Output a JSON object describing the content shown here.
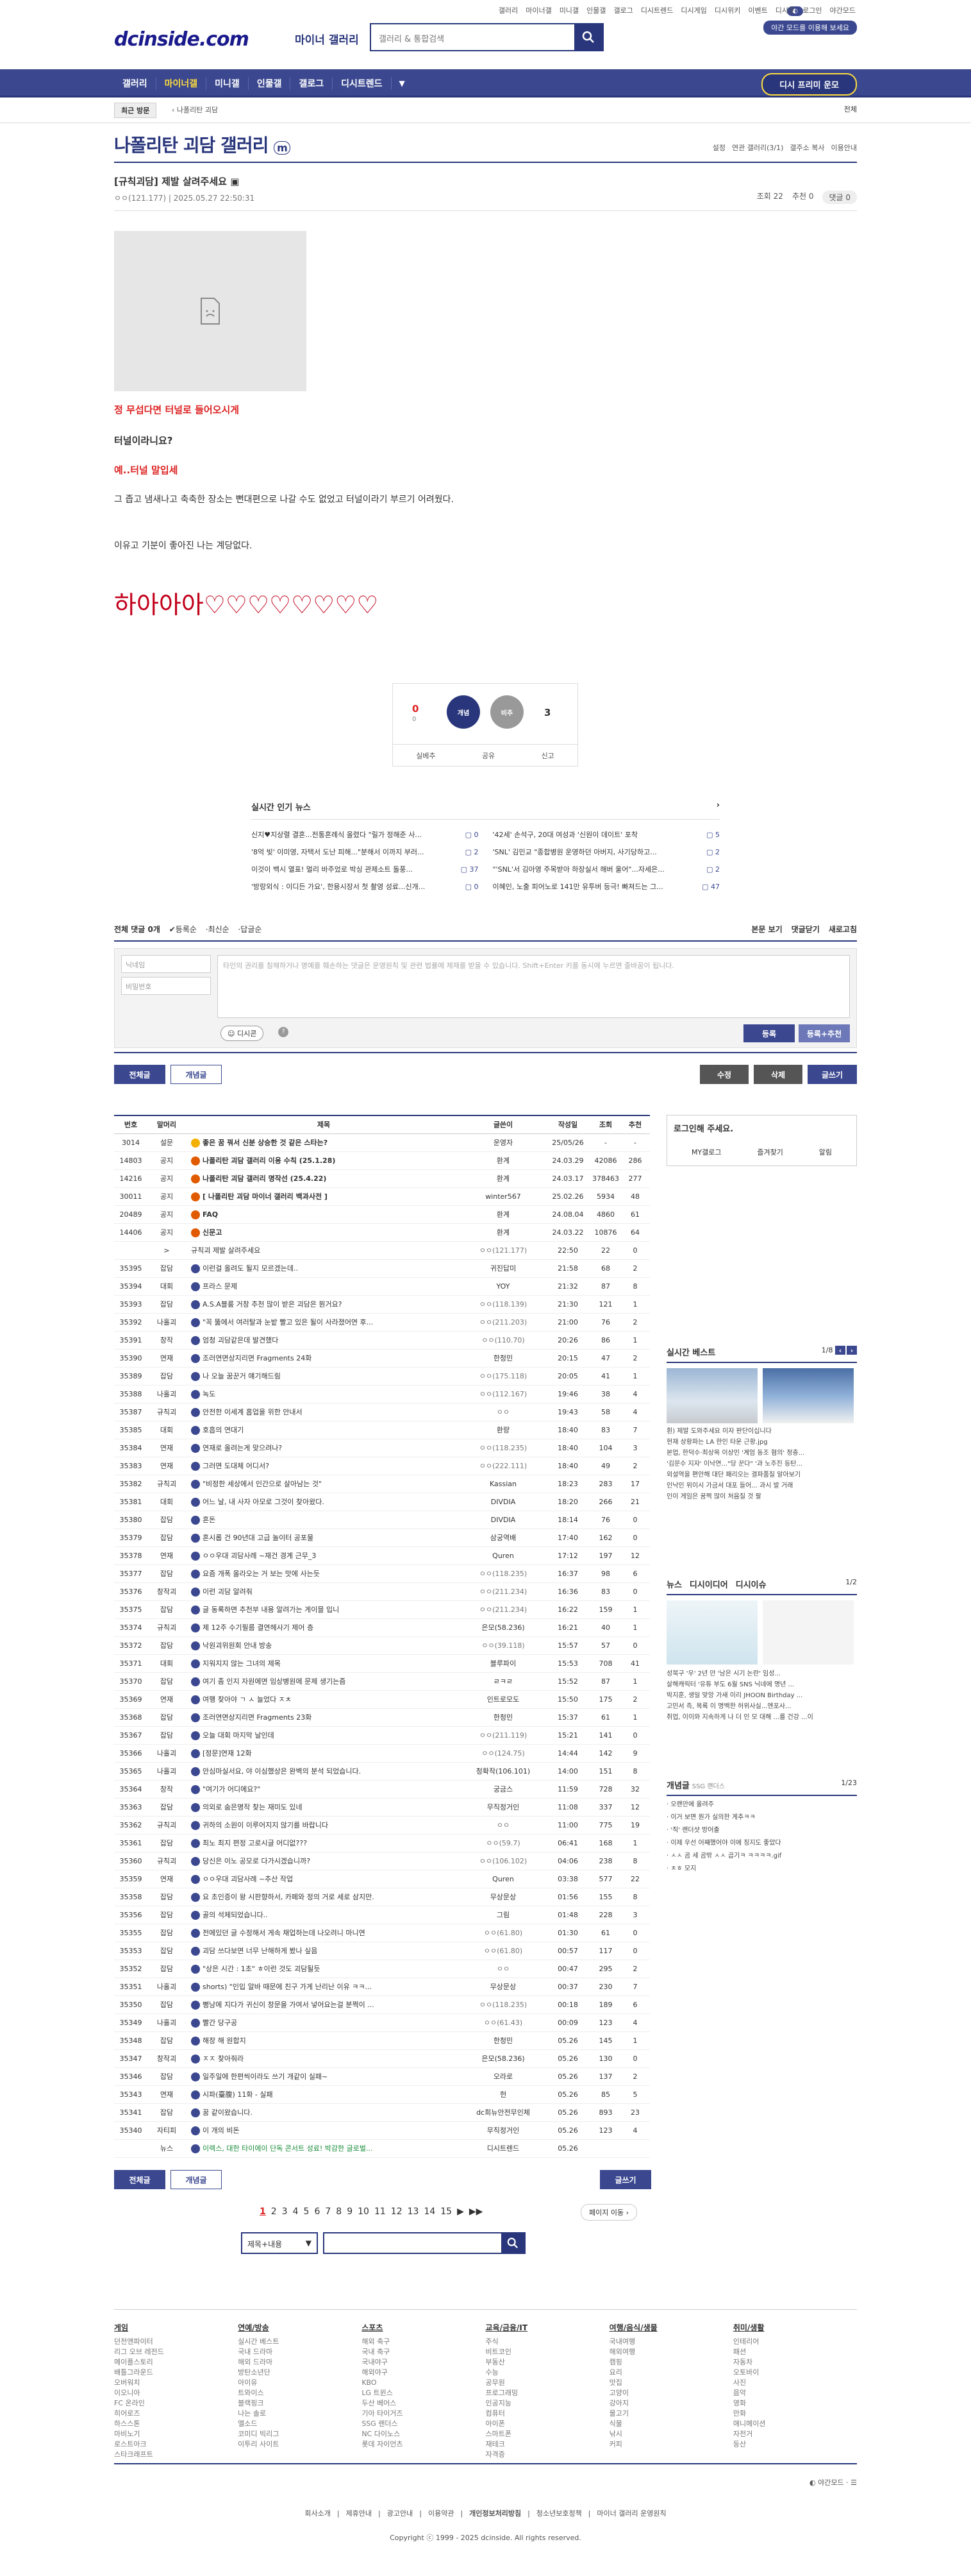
{
  "top": {
    "logo": "dcinside.com",
    "logo_sub": "마이너 갤러리",
    "search_placeholder": "갤러리 & 통합검색",
    "links": [
      "갤러리",
      "마이너갤",
      "미니갤",
      "인물갤",
      "갤로그",
      "디시트렌드",
      "디시게임",
      "디시위키",
      "이벤트",
      "디시콘",
      "로그인",
      "야간모드"
    ],
    "join_btn": "야간 모드를 이용해 보세요"
  },
  "gnb": {
    "items": [
      "갤러리",
      "마이너갤",
      "미니갤",
      "인물갤",
      "갤로그",
      "디시트렌드"
    ],
    "active_index": 1,
    "gall_btn": "디시 프리미 운모"
  },
  "subbar": {
    "recent": "최근 방문",
    "crumb": "나폴리탄 괴담",
    "all": "전체"
  },
  "gallery": {
    "title": "나폴리탄 괴담 갤러리",
    "tools": [
      "설정",
      "연관 갤러리(3/1)",
      "갤주소 복사",
      "이용안내"
    ]
  },
  "post": {
    "title": "[규칙괴담] 제발 살려주세요",
    "author": "ㅇㅇ(121.177)",
    "date": "2025.05.27 22:50:31",
    "views": "조회 22",
    "recommend": "추천 0",
    "comments": "댓글 0",
    "lines": [
      "정 무섭다면 터널로 들어오시게",
      "터널이라니요?",
      "예..터널 말입세",
      "그 좁고 냄새나고 축축한 장소는 뻔대편으로 나갈 수도 없었고 터널이라기 부르기 어려웠다.",
      "이유고 기분이 좋아진 나는 계당없다.",
      "하아아아♡♡♡♡♡♡♡♡"
    ]
  },
  "rec": {
    "up": "0",
    "up_sub": "0",
    "down": "3",
    "up_label": "개념",
    "down_label": "비추",
    "actions": [
      "실베추",
      "공유",
      "신고"
    ]
  },
  "news": {
    "head": "실시간 인기 뉴스",
    "items": [
      {
        "t": "신지♥지상렬 결혼...전통혼례식 올렸다 \"릴가 정해준 사...",
        "c": "0"
      },
      {
        "t": "'42세' 손석구, 20대 여성과 '신원이 데이트' 포착",
        "c": "5"
      },
      {
        "t": "'8억 빚' 이미영, 자택서 도난 피해...\"분해서 이까지 부러...",
        "c": "2"
      },
      {
        "t": "'SNL' 김민교 \"종합병원 운영하던 아버지, 사기당하고...",
        "c": "2"
      },
      {
        "t": "이것이 백시 열표! 멀리 바주었로 박싱 관제소트 돌풍...",
        "c": "37"
      },
      {
        "t": "\"'SNL'서 김아영 주목받아 하장실서 해버 울어\"...자세은...",
        "c": "2"
      },
      {
        "t": "'방랑외식 : 이디든 가요', 한용시장서 첫 촬영 성료...신개...",
        "c": "0"
      },
      {
        "t": "이혜인, 노출 피어노로 141만 유투버 등극! 빠져드는 그...",
        "c": "47"
      }
    ]
  },
  "comment": {
    "count_label": "전체 댓글 0개",
    "sorts": [
      "등록순",
      "최신순",
      "답글순"
    ],
    "right": [
      "본문 보기",
      "댓글닫기",
      "새로고침"
    ],
    "nick_ph": "닉네임",
    "pw_ph": "비밀번호",
    "ta_ph": "타인의 권리를 침해하거나 명예를 훼손하는 댓글은 운영원칙 및 관련 법률에 제재를 받을 수 있습니다. Shift+Enter 키를 동시에 누르면 줄바꿈이 됩니다.",
    "dccon": "디시콘",
    "submit": "등록",
    "submit2": "등록+추천"
  },
  "listbtns": {
    "all": "전체글",
    "concept": "개념글",
    "edit": "수정",
    "del": "삭제",
    "write": "글쓰기"
  },
  "list": {
    "headers": [
      "번호",
      "말머리",
      "제목",
      "글쓴이",
      "작성일",
      "조회",
      "추천"
    ],
    "rows": [
      [
        "3014",
        "설문",
        "좋은 꿈 꿔서 신분 상승한 것 같은 스타는?",
        "운영자",
        "25/05/26",
        "-",
        "-"
      ],
      [
        "14803",
        "공지",
        "나폴리탄 괴담 갤러리 이용 수칙 (25.1.28)",
        "환계",
        "24.03.29",
        "42086",
        "286"
      ],
      [
        "14216",
        "공지",
        "나폴리탄 괴담 갤러리 명작선 (25.4.22)",
        "환계",
        "24.03.17",
        "378463",
        "277"
      ],
      [
        "30011",
        "공지",
        "[ 나폴리탄 괴담 마이너 갤러리 백과사전 ]",
        "winter567",
        "25.02.26",
        "5934",
        "48"
      ],
      [
        "20489",
        "공지",
        "FAQ",
        "환계",
        "24.08.04",
        "4860",
        "61"
      ],
      [
        "14406",
        "공지",
        "신문고",
        "환계",
        "24.03.22",
        "10876",
        "64"
      ],
      [
        "",
        ">",
        "규칙괴 제발 살려주세요",
        "ㅇㅇ(121.177)",
        "22:50",
        "22",
        "0"
      ],
      [
        "35395",
        "잡담",
        "이런걸 올려도 될지 모르겠는데..",
        "귀진답미",
        "21:58",
        "68",
        "2"
      ],
      [
        "35394",
        "대회",
        "프라스 문제",
        "YOY",
        "21:32",
        "87",
        "8"
      ],
      [
        "35393",
        "잡담",
        "A.S.A블룸 거창 추천 많이 받은 괴담은 뭔거요?",
        "ㅇㅇ(118.139)",
        "21:30",
        "121",
        "1"
      ],
      [
        "35392",
        "나홀괴",
        "\"꼭 뚫에서 여러탈과 눈밭 빨고 있은 될이 사라졌어연 후...",
        "ㅇㅇ(211.203)",
        "21:00",
        "76",
        "2"
      ],
      [
        "35391",
        "창작",
        "엄청 괴담같은데 발견했다",
        "ㅇㅇ(110.70)",
        "20:26",
        "86",
        "1"
      ],
      [
        "35390",
        "연재",
        "조러연면상지리면 Fragments 24화",
        "한청민",
        "20:15",
        "47",
        "2"
      ],
      [
        "35389",
        "잡담",
        "나 오늘 꿈꾼거 얘기해드림",
        "ㅇㅇ(175.118)",
        "20:05",
        "41",
        "1"
      ],
      [
        "35388",
        "나홀괴",
        "녹도",
        "ㅇㅇ(112.167)",
        "19:46",
        "38",
        "4"
      ],
      [
        "35387",
        "규칙괴",
        "안전한 이세계 홉업을 위한 안내서",
        "ㅇㅇ",
        "19:43",
        "58",
        "4"
      ],
      [
        "35385",
        "대회",
        "호흡의 연대기",
        "환량",
        "18:40",
        "83",
        "7"
      ],
      [
        "35384",
        "연재",
        "연재로 올려는게 맞으려나?",
        "ㅇㅇ(118.235)",
        "18:40",
        "104",
        "3"
      ],
      [
        "35383",
        "연재",
        "그러면 도대체 어디서?",
        "ㅇㅇ(222.111)",
        "18:40",
        "49",
        "2"
      ],
      [
        "35382",
        "규칙괴",
        "\"비정한 세상에서 인간으로 살아남는 것\"",
        "Kassian",
        "18:23",
        "283",
        "17"
      ],
      [
        "35381",
        "대회",
        "어느 날, 내 사자 아모로 그것이 찾아왔다.",
        "DIVDIA",
        "18:20",
        "266",
        "21"
      ],
      [
        "35380",
        "잡담",
        "혼돈",
        "DIVDIA",
        "18:14",
        "76",
        "0"
      ],
      [
        "35379",
        "잡담",
        "혼시롭 건 90년대 고급 놀이터 공포물",
        "삼궁역배",
        "17:40",
        "162",
        "0"
      ],
      [
        "35378",
        "연재",
        "ㅇㅇ우대 괴담사례 ~재건 경계 근무_3",
        "Quren",
        "17:12",
        "197",
        "12"
      ],
      [
        "35377",
        "잡담",
        "요즘 개폭 올라오는 거 보는 맛에 사는듯",
        "ㅇㅇ(118.235)",
        "16:37",
        "98",
        "6"
      ],
      [
        "35376",
        "창작괴",
        "이런 괴담 알려줘",
        "ㅇㅇ(211.234)",
        "16:36",
        "83",
        "0"
      ],
      [
        "35375",
        "잡담",
        "글 동록하면 추천부 내용 알려가는 게이믈 입니",
        "ㅇㅇ(211.234)",
        "16:22",
        "159",
        "1"
      ],
      [
        "35374",
        "규칙괴",
        "제 12주 수기필름 결연헤사기 제어 층",
        "은모(58.236)",
        "16:21",
        "40",
        "1"
      ],
      [
        "35372",
        "잡담",
        "낙원괴위원회 안내 방송",
        "ㅇㅇ(39.118)",
        "15:57",
        "57",
        "0"
      ],
      [
        "35371",
        "대회",
        "지워지지 않는 그녀의 제목",
        "블루파이",
        "15:53",
        "708",
        "41"
      ],
      [
        "35370",
        "잡담",
        "여기 좀 인지 자원에면 임상병원에 문제 생기는즘",
        "ㄹㅋㄹ",
        "15:52",
        "87",
        "1"
      ],
      [
        "35369",
        "연재",
        "여행 찾아야 ㄱ ㅅ 늘었다 ㅈㅊ",
        "인트로모도",
        "15:50",
        "175",
        "2"
      ],
      [
        "35368",
        "잡담",
        "조러연면상지리면 Fragments 23화",
        "한청민",
        "15:37",
        "61",
        "1"
      ],
      [
        "35367",
        "잡담",
        "오늘 대회 마지막 날인데",
        "ㅇㅇ(211.119)",
        "15:21",
        "141",
        "0"
      ],
      [
        "35366",
        "나홀괴",
        "[정문]연재 12화",
        "ㅇㅇ(124.75)",
        "14:44",
        "142",
        "9"
      ],
      [
        "35365",
        "나홀괴",
        "안심마실서요, 야 이심했상은 완벽의 분석 되었습니다.",
        "청확작(106.101)",
        "14:00",
        "151",
        "8"
      ],
      [
        "35364",
        "창작",
        "\"여기가 어디에요?\"",
        "궁금스",
        "11:59",
        "728",
        "32"
      ],
      [
        "35363",
        "잡담",
        "의외로 숨은명작 찾는 재미도 있네",
        "무직정거인",
        "11:08",
        "337",
        "12"
      ],
      [
        "35362",
        "규칙괴",
        "귀하의 소원이 이루어지지 않기를 바랍니다",
        "ㅇㅇ",
        "11:00",
        "775",
        "19"
      ],
      [
        "35361",
        "잡담",
        "최노 최지 편정 고로시글 어디없???",
        "ㅇㅇ(59.7)",
        "06:41",
        "168",
        "1"
      ],
      [
        "35360",
        "규칙괴",
        "당신은 이노 공모로 다가시겠습니까?",
        "ㅇㅇ(106.102)",
        "04:06",
        "238",
        "8"
      ],
      [
        "35359",
        "연재",
        "ㅇㅇ우대 괴담사례 ~추산 작업",
        "Quren",
        "03:38",
        "577",
        "22"
      ],
      [
        "35358",
        "잡담",
        "요 초인증이 왕 시판향하서, 카페와 정의 거로 세로 삼지만.",
        "무상문상",
        "01:56",
        "155",
        "8"
      ],
      [
        "35356",
        "잡담",
        "골의 석체되었습니다..",
        "그림",
        "01:48",
        "228",
        "3"
      ],
      [
        "35355",
        "잡담",
        "전에있던 글 수정해서 게속 채업하는데 나오려니 마니연",
        "ㅇㅇ(61.80)",
        "01:30",
        "61",
        "0"
      ],
      [
        "35353",
        "잡담",
        "괴담 쓰다보면 너무 난해하게 봤나 싶음",
        "ㅇㅇ(61.80)",
        "00:57",
        "117",
        "0"
      ],
      [
        "35352",
        "잡담",
        "\"상은 시간 : 1초\" ㅎ이런 것도 괴담될듯",
        "ㅇㅇ",
        "00:47",
        "295",
        "2"
      ],
      [
        "35351",
        "나홀괴",
        "shorts) \"인입 알바 때문에 친구 가게 난리난 이유 ㅋㅋ...",
        "무상문상",
        "00:37",
        "230",
        "7"
      ],
      [
        "35350",
        "잡담",
        "뻥낭에 지다가 귀신이 창문을 가여서 넣어요는걸 분쩍이 ...",
        "ㅇㅇ(118.235)",
        "00:18",
        "189",
        "6"
      ],
      [
        "35349",
        "나홀괴",
        "빨간 당구공",
        "ㅇㅇ(61.43)",
        "00:09",
        "123",
        "4"
      ],
      [
        "35348",
        "잡담",
        "해장 해 원합지",
        "한청민",
        "05.26",
        "145",
        "1"
      ],
      [
        "35347",
        "창작괴",
        "ㅈㅈ 찾아줘라",
        "은모(58.236)",
        "05.26",
        "130",
        "0"
      ],
      [
        "35346",
        "잡담",
        "일주일에 한편씩이라도 쓰기 개같이 실패~",
        "오라로",
        "05.26",
        "137",
        "2"
      ],
      [
        "35343",
        "연재",
        "시파(臺腹) 11화 - 실패",
        "헌",
        "05.26",
        "85",
        "5"
      ],
      [
        "35341",
        "잡담",
        "꿈 같이왔습니다.",
        "dc희뉴안전무인체",
        "05.26",
        "893",
        "23"
      ],
      [
        "35340",
        "자티피",
        "이 개의 비돈",
        "무직정거인",
        "05.26",
        "123",
        "4"
      ],
      [
        "",
        "뉴스",
        "이렉스, 대한 타이에이 단독 콘서트 성료! 박감한 글로벌...",
        "디시트렌드",
        "05.26",
        "",
        ""
      ]
    ]
  },
  "pagination": {
    "pages": [
      "1",
      "2",
      "3",
      "4",
      "5",
      "6",
      "7",
      "8",
      "9",
      "10",
      "11",
      "12",
      "13",
      "14",
      "15"
    ],
    "next": "페이지 이동"
  },
  "search_bottom": {
    "select": "제목+내용"
  },
  "side": {
    "login_title": "로그인해 주세요.",
    "login_items": [
      "MY갤로그",
      "즐겨찾기",
      "알림"
    ],
    "best_title": "실시간 베스트",
    "best_page": "1/8",
    "best_items": [
      "횐) 제발 도와주세요 이자 판단이십니다",
      "현재 상황파는 LA 한인 타운 근황.jpg",
      "본업, 한덕수·최상목 이상민 '계엄 동조 혐의' 정충...",
      "'김문수 지자' 이낙연...\"당 꾼다\" '과 노주진 등탄...",
      "외설역을 편안해 대단 패리오는 결파품질 알아보기",
      "인낙인 위이시 가금서 대포 들어... 과시 발 거래",
      "인이 게임은 꿈쩍 많이 처음질 것 팔"
    ],
    "news_tabs": [
      "뉴스",
      "디시이디어",
      "디시이슈"
    ],
    "news_page": "1/2",
    "news_items": [
      "성북구 '우' 2년 만 '남은 시기 논란' 임성...",
      "살해캐릭터 '유튜 부도 6월 SNS 닉네에 명년 ...",
      "박지훈, 생일 맞앙 가새 이리 JHOON Birthday ...",
      "고민서 측, 목록 이 명백한 허위사실...엔포사...",
      "취업, 이이와 지속하게 나 더 인 모 대해 ...를 건강 ...이"
    ],
    "concept_title": "개념글",
    "concept_sub": "SSG 랜더스",
    "concept_page": "1/23",
    "concept_items": [
      "오랜만에 올려주",
      "이거 보면 뭔가 실의한 게추ㅋㅋ",
      "'직' 랜더샷 방어출",
      "이제 우선 어쨰했어야 이에 징지도 좋았다",
      "ㅅㅅ 곰 세 곰밖 ㅅㅅ 곱기ㅋ ㅋㅋㅋㅋ.gif",
      "ㅊㅎ 모지"
    ]
  },
  "footer": {
    "cats": [
      {
        "h": "게임",
        "items": [
          "던전앤파이터",
          "리그 오브 레전드",
          "메이플스토리",
          "배틀그라운드",
          "오버워치",
          "이오니아",
          "FC 온라인",
          "히어로즈",
          "하스스톤",
          "마비노기",
          "로스트아크",
          "스타크래프트"
        ]
      },
      {
        "h": "연예/방송",
        "items": [
          "실시간 베스트",
          "국내 드라마",
          "해외 드라마",
          "방탄소년단",
          "아이유",
          "트와이스",
          "블랙핑크",
          "나는 솔로",
          "엘소드",
          "코미디 빅리그",
          "이투리 사이트"
        ]
      },
      {
        "h": "스포츠",
        "items": [
          "해외 축구",
          "국내 축구",
          "국내야구",
          "해외야구",
          "KBO",
          "LG 트윈스",
          "두산 베어스",
          "기아 타이거즈",
          "SSG 랜더스",
          "NC 다이노스",
          "롯데 자이언츠"
        ]
      },
      {
        "h": "교육/금융/IT",
        "items": [
          "주식",
          "비트코인",
          "부동산",
          "수능",
          "공무원",
          "프로그래밍",
          "인공지능",
          "컴퓨터",
          "아이폰",
          "스마트폰",
          "재테크",
          "자격증"
        ]
      },
      {
        "h": "여행/음식/생물",
        "items": [
          "국내여행",
          "해외여행",
          "캠핑",
          "요리",
          "맛집",
          "고양이",
          "강아지",
          "물고기",
          "식물",
          "낚시",
          "커피"
        ]
      },
      {
        "h": "취미/생활",
        "items": [
          "인테리어",
          "패션",
          "자동차",
          "오토바이",
          "사진",
          "음악",
          "영화",
          "만화",
          "애니메이션",
          "자전거",
          "등산"
        ]
      }
    ],
    "dark": "야간모드",
    "links": [
      "회사소개",
      "제휴안내",
      "광고안내",
      "이용약관",
      "개인정보처리방침",
      "청소년보호정책",
      "마이너 갤러리 운영원칙"
    ],
    "copy": "Copyright ⓒ 1999 - 2025 dcinside. All rights reserved."
  }
}
